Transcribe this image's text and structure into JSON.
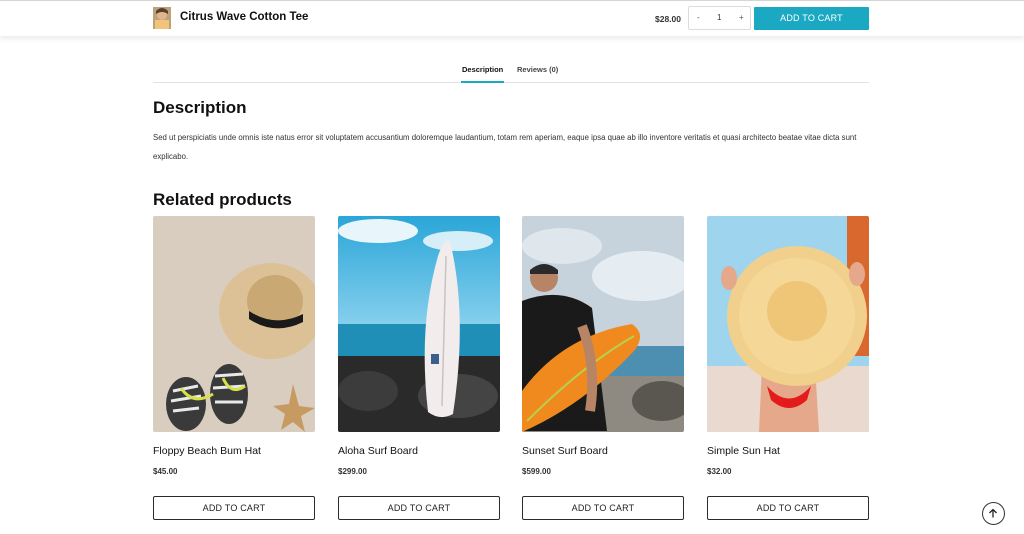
{
  "sticky_bar": {
    "product_title": "Citrus Wave Cotton Tee",
    "price": "$28.00",
    "quantity": "1",
    "minus_label": "-",
    "plus_label": "+",
    "add_to_cart": "ADD TO CART",
    "accent_color": "#1aa8c2"
  },
  "tabs": [
    {
      "label": "Description",
      "active": true
    },
    {
      "label": "Reviews (0)",
      "active": false
    }
  ],
  "description": {
    "heading": "Description",
    "text": "Sed ut perspiciatis unde omnis iste natus error sit voluptatem accusantium doloremque laudantium, totam rem aperiam, eaque ipsa quae ab illo inventore veritatis et quasi architecto beatae vitae dicta sunt explicabo."
  },
  "related": {
    "heading": "Related products",
    "products": [
      {
        "name": "Floppy Beach Bum Hat",
        "price": "$45.00",
        "button": "ADD TO CART",
        "image_icon": "straw-hat-flip-flops"
      },
      {
        "name": "Aloha Surf Board",
        "price": "$299.00",
        "button": "ADD TO CART",
        "image_icon": "surfboard-sea"
      },
      {
        "name": "Sunset Surf Board",
        "price": "$599.00",
        "button": "ADD TO CART",
        "image_icon": "orange-surfboard-surfer"
      },
      {
        "name": "Simple Sun Hat",
        "price": "$32.00",
        "button": "ADD TO CART",
        "image_icon": "sun-hat-woman"
      }
    ]
  },
  "scroll_top_icon": "arrow-up-icon"
}
